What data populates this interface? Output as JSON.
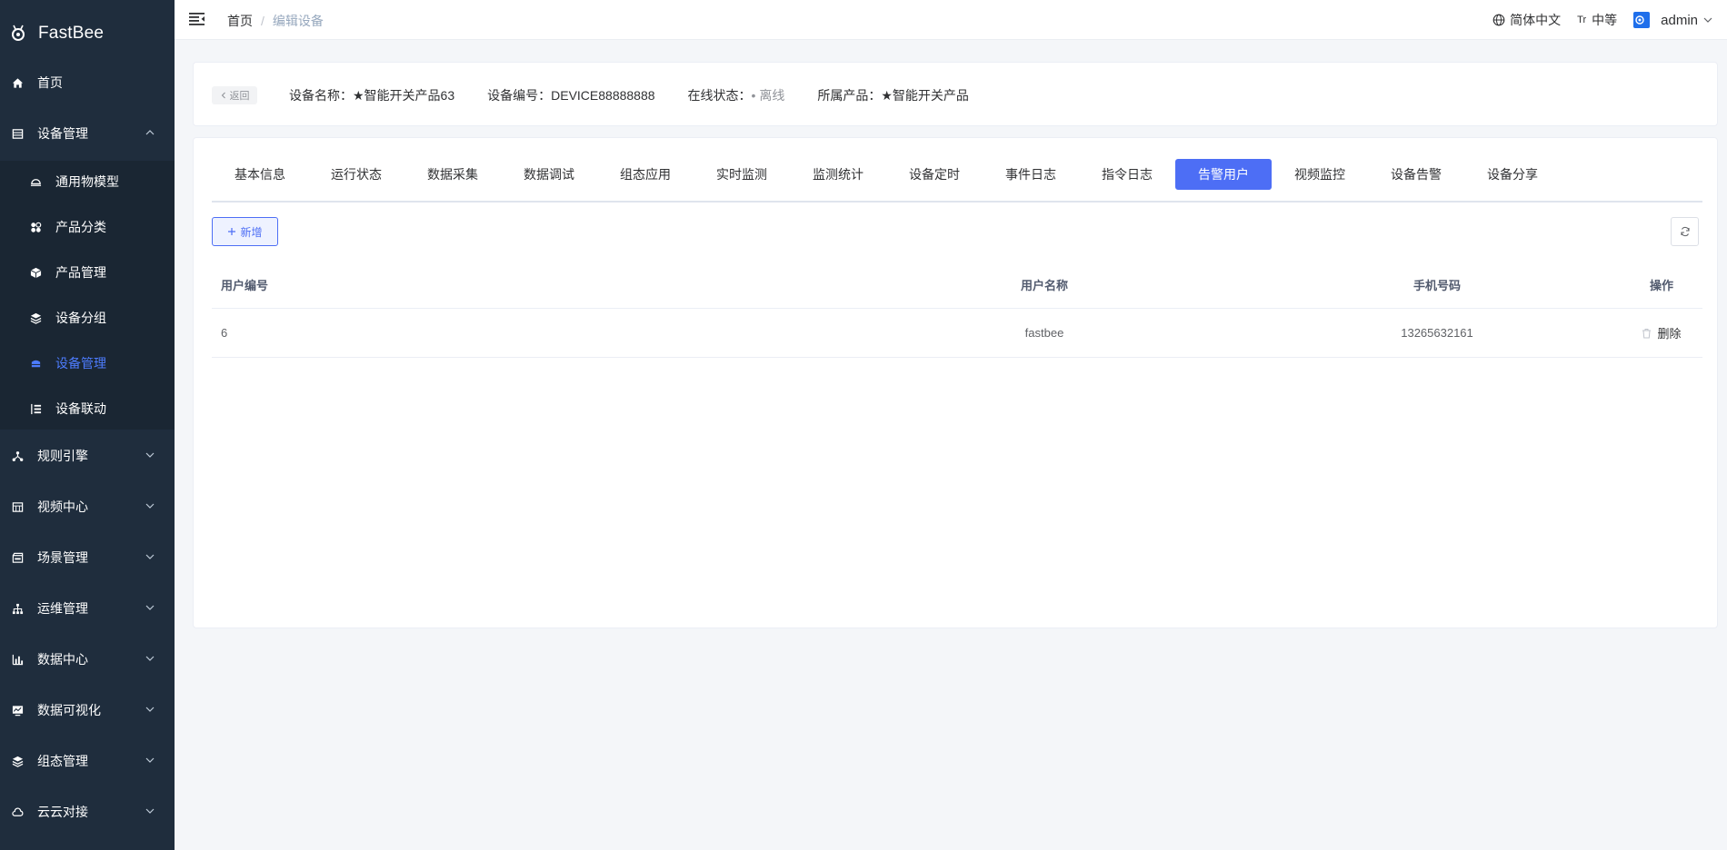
{
  "app": {
    "name": "FastBee"
  },
  "sidebar": {
    "items": [
      {
        "label": "首页",
        "icon": "home-icon"
      },
      {
        "label": "设备管理",
        "icon": "device-mgmt-icon",
        "expanded": true
      },
      {
        "label": "通用物模型",
        "icon": "model-icon"
      },
      {
        "label": "产品分类",
        "icon": "category-icon"
      },
      {
        "label": "产品管理",
        "icon": "product-icon"
      },
      {
        "label": "设备分组",
        "icon": "group-icon"
      },
      {
        "label": "设备管理",
        "icon": "device-icon",
        "active": true
      },
      {
        "label": "设备联动",
        "icon": "linkage-icon"
      },
      {
        "label": "规则引擎",
        "icon": "rule-icon"
      },
      {
        "label": "视频中心",
        "icon": "video-icon"
      },
      {
        "label": "场景管理",
        "icon": "scene-icon"
      },
      {
        "label": "运维管理",
        "icon": "ops-icon"
      },
      {
        "label": "数据中心",
        "icon": "data-icon"
      },
      {
        "label": "数据可视化",
        "icon": "visual-icon"
      },
      {
        "label": "组态管理",
        "icon": "config-icon"
      },
      {
        "label": "云云对接",
        "icon": "cloud-icon"
      }
    ]
  },
  "header": {
    "breadcrumb": {
      "home": "首页",
      "sep": "/",
      "current": "编辑设备"
    },
    "language": "简体中文",
    "font_size_icon": "Tr",
    "size": "中等",
    "user": "admin"
  },
  "device_info": {
    "back_label": "返回",
    "name_label": "设备名称：",
    "name_value": "★智能开关产品63",
    "serial_label": "设备编号：",
    "serial_value": "DEVICE88888888",
    "status_label": "在线状态：",
    "status_value": "• 离线",
    "product_label": "所属产品：",
    "product_value": "★智能开关产品"
  },
  "tabs": [
    "基本信息",
    "运行状态",
    "数据采集",
    "数据调试",
    "组态应用",
    "实时监测",
    "监测统计",
    "设备定时",
    "事件日志",
    "指令日志",
    "告警用户",
    "视频监控",
    "设备告警",
    "设备分享"
  ],
  "active_tab": "告警用户",
  "toolbar": {
    "add_label": "新增"
  },
  "table": {
    "headers": {
      "user_id": "用户编号",
      "user_name": "用户名称",
      "phone": "手机号码",
      "action": "操作"
    },
    "rows": [
      {
        "user_id": "6",
        "user_name": "fastbee",
        "phone": "13265632161",
        "action": "删除"
      }
    ]
  },
  "colors": {
    "accent": "#4d6ef5",
    "sidebar_bg": "#1f2d3d",
    "active_menu": "#4d7cfe"
  }
}
